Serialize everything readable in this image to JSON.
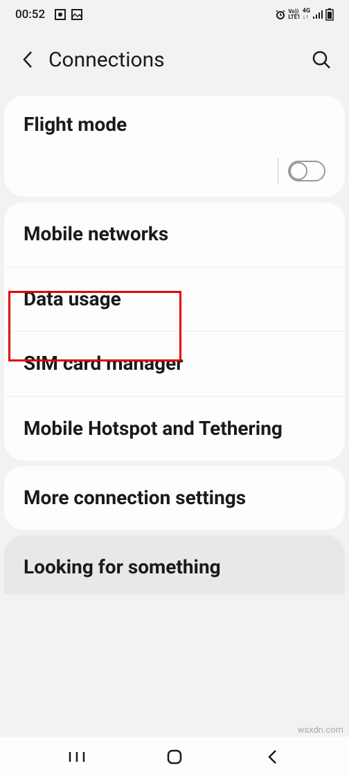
{
  "status": {
    "time": "00:52"
  },
  "header": {
    "title": "Connections"
  },
  "cards": {
    "flight_mode": "Flight mode",
    "mobile_networks": "Mobile networks",
    "data_usage": "Data usage",
    "sim_card_manager": "SIM card manager",
    "hotspot": "Mobile Hotspot and Tethering",
    "more_settings": "More connection settings",
    "looking_for": "Looking for something"
  },
  "watermark": "wsxdn.com"
}
